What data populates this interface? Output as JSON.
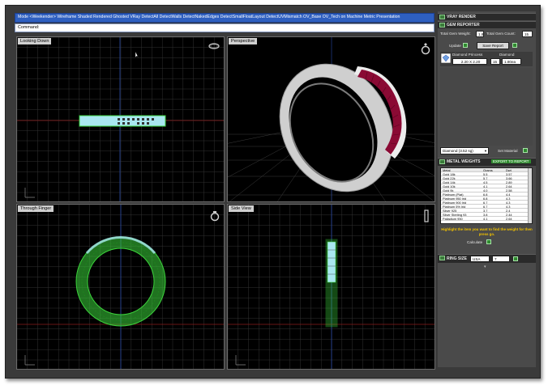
{
  "menubar": {
    "text": "Mode <Weekender>   Wireframe  Shaded  Rendered  Ghosted  VRay  DetectAll  DetectWalls  DetectNakedEdges  DetectSmallFloatLayout  DetectUVMismatch  OV_Base  OV_Tech  on  Machine  Metric  Presentation"
  },
  "command": {
    "label": "Command:"
  },
  "viewports": {
    "top": {
      "label": "Looking Down"
    },
    "perspective": {
      "label": "Perspective"
    },
    "front": {
      "label": "Through Finger"
    },
    "side": {
      "label": "Side View"
    }
  },
  "panel": {
    "vray": {
      "title": "VRAY RENDER"
    },
    "gem": {
      "title": "GEM REPORTER",
      "weight_label": "Total Gem Weight:",
      "weight_value": "1.8",
      "count_label": "Total Gem Count:",
      "count_value": "15",
      "update_label": "Update",
      "save_label": "Save Report",
      "columns": [
        "Diamond Princess",
        "Diamond"
      ],
      "row": {
        "size": "2.20 X 2.20",
        "count": "15",
        "weight": "1.80ea"
      }
    },
    "material": {
      "select_value": "Diamond  (3.52 sg)",
      "set_label": "Set Material"
    },
    "metal": {
      "title": "METAL WEIGHTS",
      "subtitle": "EXPORT TO REPORT",
      "headers": [
        "Metal",
        "Grams",
        "Dwt"
      ],
      "rows": [
        [
          "Gold 18k",
          "5.5",
          "3.57"
        ],
        [
          "Gold 22k",
          "5.7",
          "3.66"
        ],
        [
          "Gold 14k",
          "4.5",
          "2.89"
        ],
        [
          "Gold 10k",
          "4.1",
          "2.64"
        ],
        [
          "Gold 9k",
          "4.0",
          "2.58"
        ],
        [
          "Platinum (Plat)",
          "6.8",
          "4.4"
        ],
        [
          "Platinum 950 Irid",
          "6.8",
          "4.3"
        ],
        [
          "Platinum 900 Irid",
          "6.7",
          "4.3"
        ],
        [
          "Platinum 5% Irid",
          "6.7",
          "4.3"
        ],
        [
          "Silver 925",
          "3.7",
          "2.4"
        ],
        [
          "Silver Sterling 93",
          "3.8",
          "2.44"
        ],
        [
          "Palladium 950",
          "4.1",
          "2.64"
        ]
      ]
    },
    "hint": "Highlight the item you want to find the weight for then press go.",
    "calculate_label": "Calculate",
    "ring": {
      "title": "RING SIZE",
      "region": "USA",
      "size": "7"
    }
  },
  "colors": {
    "gem": "#8a0a34",
    "band": "#e8e8e8",
    "wire": "#3bd23b",
    "grid": "#3a3a3a",
    "axis_red": "#8a1a1a",
    "axis_blue": "#2a4aa8",
    "menubar": "#2e5fc0"
  }
}
